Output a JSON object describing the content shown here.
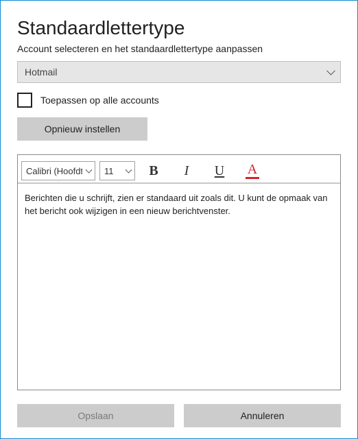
{
  "header": {
    "title": "Standaardlettertype",
    "subtitle": "Account selecteren en het standaardlettertype aanpassen"
  },
  "account": {
    "selected": "Hotmail"
  },
  "apply_all": {
    "label": "Toepassen op alle accounts",
    "checked": false
  },
  "reset": {
    "label": "Opnieuw instellen"
  },
  "editor": {
    "font_name": "Calibri (Hoofdtekst)",
    "font_size": "11",
    "bold_glyph": "B",
    "italic_glyph": "I",
    "underline_glyph": "U",
    "color_glyph": "A",
    "preview_text": "Berichten die u schrijft, zien er standaard uit zoals dit. U kunt de opmaak van het bericht ook wijzigen in een nieuw berichtvenster."
  },
  "footer": {
    "save": "Opslaan",
    "cancel": "Annuleren"
  }
}
